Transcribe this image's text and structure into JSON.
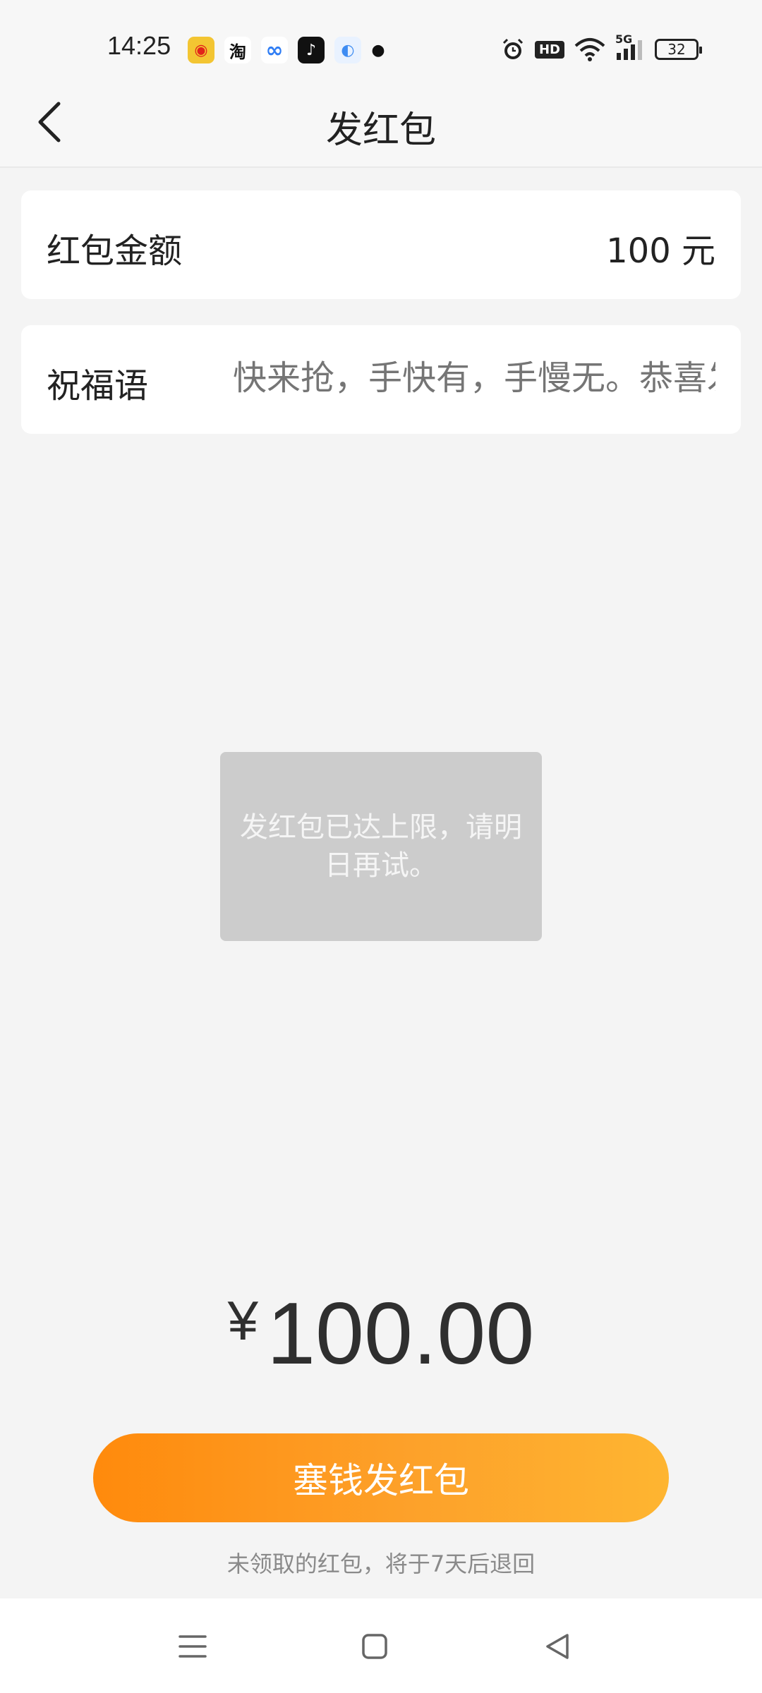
{
  "status_bar": {
    "time": "14:25",
    "apps": [
      {
        "icon": "weibo-icon",
        "color": "#f3c532",
        "glyph": "◉"
      },
      {
        "icon": "taobao-icon",
        "color": "#ffffff",
        "glyph": "淘"
      },
      {
        "icon": "cloud-icon",
        "color": "#ffffff",
        "glyph": "∞"
      },
      {
        "icon": "tiktok-icon",
        "color": "#111111",
        "glyph": "♪"
      },
      {
        "icon": "browser-icon",
        "color": "#3e8cf2",
        "glyph": "◐"
      }
    ],
    "network": "5G",
    "hd": "HD",
    "battery": "32"
  },
  "nav": {
    "title": "发红包"
  },
  "amount": {
    "label": "红包金额",
    "value": "100 元"
  },
  "greeting": {
    "label": "祝福语",
    "placeholder": "快来抢，手快有，手慢无。恭喜发财"
  },
  "toast": {
    "message": "发红包已达上限，请明日再试。"
  },
  "total": {
    "currency": "¥",
    "amount": "100.00"
  },
  "send_button": {
    "label": "塞钱发红包"
  },
  "notice": "未领取的红包，将于7天后退回",
  "colors": {
    "accent_start": "#ff8a0c",
    "accent_end": "#feb531"
  }
}
